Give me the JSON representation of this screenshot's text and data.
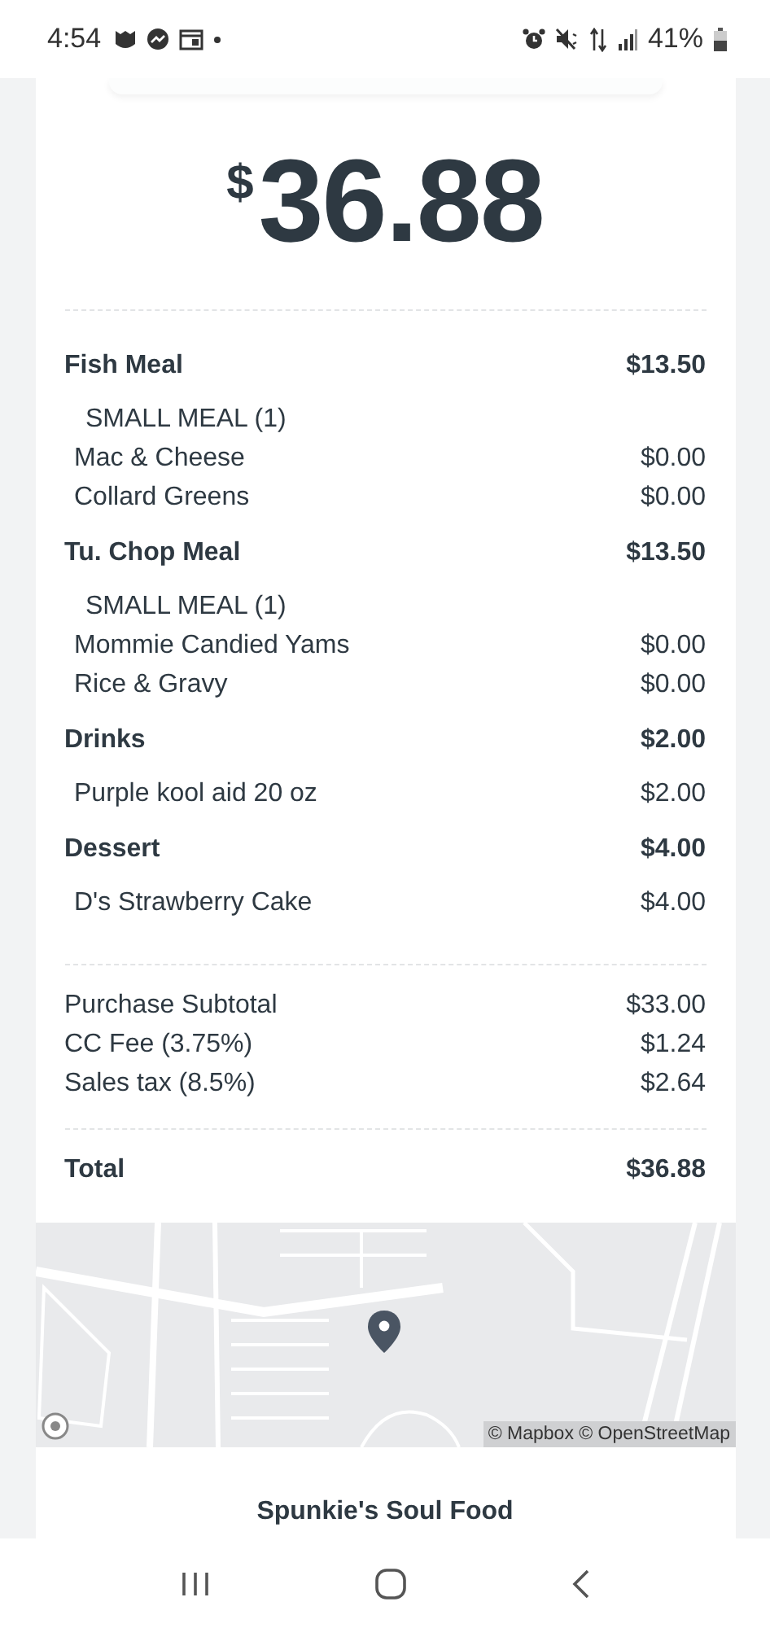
{
  "status_bar": {
    "time": "4:54",
    "battery": "41%"
  },
  "receipt": {
    "currency": "$",
    "amount": "36.88",
    "line_items": [
      {
        "name": "Fish Meal",
        "price": "$13.50",
        "modifiers": [
          "SMALL MEAL (1)"
        ],
        "items": [
          {
            "name": "Mac & Cheese",
            "price": "$0.00"
          },
          {
            "name": "Collard Greens",
            "price": "$0.00"
          }
        ]
      },
      {
        "name": "Tu. Chop Meal",
        "price": "$13.50",
        "modifiers": [
          "SMALL MEAL (1)"
        ],
        "items": [
          {
            "name": "Mommie Candied Yams",
            "price": "$0.00"
          },
          {
            "name": "Rice & Gravy",
            "price": "$0.00"
          }
        ]
      },
      {
        "name": "Drinks",
        "price": "$2.00",
        "items": [
          {
            "name": "Purple kool aid 20 oz",
            "price": "$2.00"
          }
        ]
      },
      {
        "name": "Dessert",
        "price": "$4.00",
        "items": [
          {
            "name": "D's Strawberry Cake",
            "price": "$4.00"
          }
        ]
      }
    ],
    "summary": [
      {
        "label": "Purchase Subtotal",
        "value": "$33.00"
      },
      {
        "label": "CC Fee (3.75%)",
        "value": "$1.24"
      },
      {
        "label": "Sales tax (8.5%)",
        "value": "$2.64"
      }
    ],
    "total": {
      "label": "Total",
      "value": "$36.88"
    }
  },
  "map": {
    "kind": "picture",
    "attribution": "© Mapbox © OpenStreetMap"
  },
  "restaurant_name": "Spunkie's Soul Food"
}
